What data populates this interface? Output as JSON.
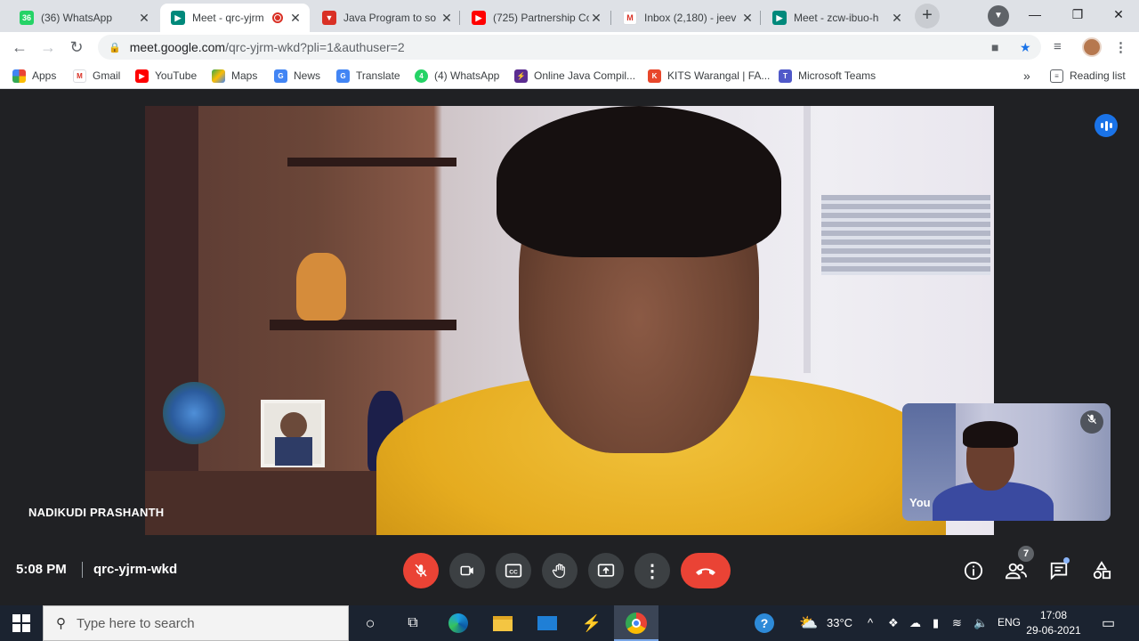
{
  "browser": {
    "tabs": [
      {
        "title": "(36) WhatsApp",
        "icon": "whatsapp-icon",
        "color": "#25d366",
        "badge": "36"
      },
      {
        "title": "Meet - qrc-yjrm",
        "icon": "google-meet-icon",
        "color": "#00897b",
        "active": true
      },
      {
        "title": "Java Program to so",
        "icon": "vlogo-icon",
        "color": "#d93025"
      },
      {
        "title": "(725) Partnership Co",
        "icon": "youtube-icon",
        "color": "#ff0000"
      },
      {
        "title": "Inbox (2,180) - jeev",
        "icon": "gmail-icon",
        "color": "#d93025"
      },
      {
        "title": "Meet - zcw-ibuo-h",
        "icon": "google-meet-icon",
        "color": "#00897b"
      }
    ],
    "url": {
      "host": "meet.google.com",
      "path": "/qrc-yjrm-wkd?pli=1&authuser=2"
    },
    "bookmarks": [
      {
        "label": "Apps",
        "icon": "apps-grid-icon"
      },
      {
        "label": "Gmail",
        "icon": "gmail-icon"
      },
      {
        "label": "YouTube",
        "icon": "youtube-icon"
      },
      {
        "label": "Maps",
        "icon": "maps-icon"
      },
      {
        "label": "News",
        "icon": "news-icon"
      },
      {
        "label": "Translate",
        "icon": "translate-icon"
      },
      {
        "label": "(4) WhatsApp",
        "icon": "whatsapp-icon"
      },
      {
        "label": "Online Java Compil...",
        "icon": "bolt-icon"
      },
      {
        "label": "KITS Warangal | FA...",
        "icon": "kits-icon"
      },
      {
        "label": "Microsoft Teams",
        "icon": "teams-icon"
      }
    ],
    "bookmarks_overflow": "»",
    "reading_list": "Reading list"
  },
  "meet": {
    "participant_name": "NADIKUDI PRASHANTH",
    "self_label": "You",
    "time": "5:08 PM",
    "meeting_code": "qrc-yjrm-wkd",
    "participant_count": "7",
    "colors": {
      "end_call": "#ea4335",
      "button_bg": "#3c4043",
      "accent": "#1a73e8"
    }
  },
  "taskbar": {
    "search_placeholder": "Type here to search",
    "temperature": "33°C",
    "language": "ENG",
    "clock_time": "17:08",
    "clock_date": "29-06-2021"
  }
}
